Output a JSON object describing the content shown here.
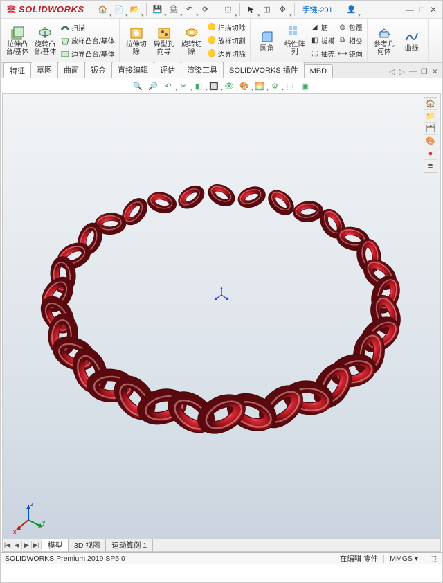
{
  "app": {
    "brand": "SOLIDWORKS",
    "doc": "手链-201...",
    "search_placeholder": ""
  },
  "qat": {
    "items": [
      "new",
      "open",
      "save",
      "print",
      "undo",
      "redo"
    ]
  },
  "ribbon": {
    "g1": {
      "b1": "拉伸凸\n台/基体",
      "b2": "旋转凸\n台/基体",
      "s1": "扫描",
      "s2": "放样凸台/基体",
      "s3": "边界凸台/基体"
    },
    "g2": {
      "b1": "拉伸切\n除",
      "b2": "异型孔\n向导",
      "b3": "旋转切\n除",
      "s1": "扫描切除",
      "s2": "放样切割",
      "s3": "边界切除"
    },
    "g3": {
      "b1": "圆角",
      "b2": "线性阵\n列",
      "s1": "筋",
      "s2": "拔模",
      "s3": "抽壳",
      "s4": "包覆",
      "s5": "相交",
      "s6": "镜向"
    },
    "g4": {
      "b1": "参考几\n何体",
      "b2": "曲线"
    }
  },
  "tabs": [
    "特征",
    "草图",
    "曲面",
    "钣金",
    "直接编辑",
    "评估",
    "渲染工具",
    "SOLIDWORKS 插件",
    "MBD"
  ],
  "bottom_tabs": [
    "模型",
    "3D 视图",
    "运动算例 1"
  ],
  "status": {
    "product": "SOLIDWORKS Premium 2019 SP5.0",
    "mode": "在编辑 零件",
    "units": "MMGS"
  },
  "triad": {
    "x": "x",
    "y": "y",
    "z": "z"
  },
  "colors": {
    "model": "#b5212b",
    "accent": "#0066cc"
  }
}
